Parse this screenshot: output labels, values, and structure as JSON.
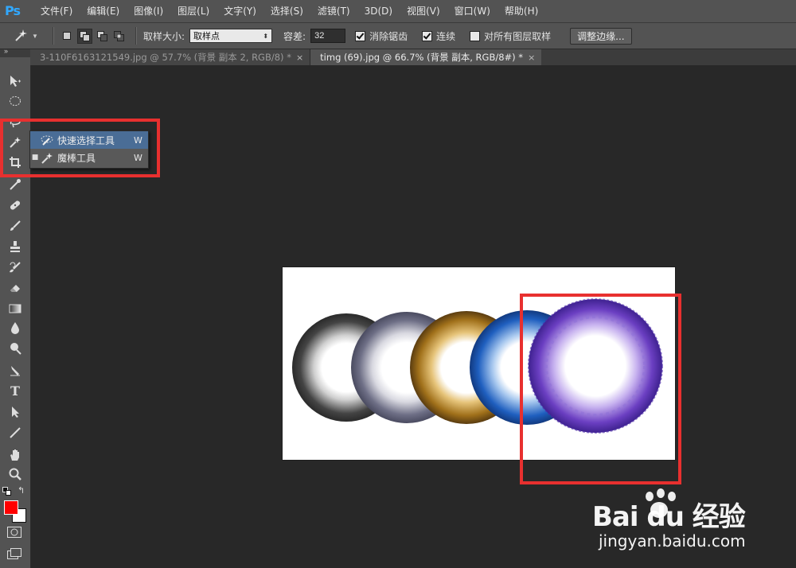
{
  "app": {
    "logo": "Ps"
  },
  "menu": [
    "文件(F)",
    "编辑(E)",
    "图像(I)",
    "图层(L)",
    "文字(Y)",
    "选择(S)",
    "滤镜(T)",
    "3D(D)",
    "视图(V)",
    "窗口(W)",
    "帮助(H)"
  ],
  "options": {
    "sample_size_label": "取样大小:",
    "sample_size_value": "取样点",
    "tolerance_label": "容差:",
    "tolerance_value": "32",
    "antialias_label": "消除锯齿",
    "contiguous_label": "连续",
    "all_layers_label": "对所有图层取样",
    "refine_edge_label": "调整边缘..."
  },
  "tabs": [
    {
      "label": "3-110F6163121549.jpg @ 57.7% (背景 副本 2, RGB/8) *",
      "close": "×"
    },
    {
      "label": "timg (69).jpg @ 66.7% (背景 副本, RGB/8#) *",
      "close": "×"
    }
  ],
  "flyout": [
    {
      "label": "快速选择工具",
      "shortcut": "W",
      "icon": "quick-selection-icon"
    },
    {
      "label": "魔棒工具",
      "shortcut": "W",
      "icon": "magic-wand-icon"
    }
  ],
  "colors": {
    "foreground": "#ff0000",
    "background": "#ffffff",
    "highlight_box": "#e8302f"
  },
  "watermark": {
    "brand": "Bai du 经验",
    "url": "jingyan.baidu.com"
  },
  "toolbox_icons": [
    "move-icon",
    "marquee-icon",
    "lasso-icon",
    "magic-wand-icon",
    "crop-icon",
    "eyedropper-icon",
    "healing-brush-icon",
    "brush-icon",
    "clone-stamp-icon",
    "history-brush-icon",
    "eraser-icon",
    "gradient-icon",
    "blur-icon",
    "dodge-icon",
    "pen-icon",
    "type-icon",
    "path-selection-icon",
    "line-icon",
    "hand-icon",
    "zoom-icon"
  ]
}
